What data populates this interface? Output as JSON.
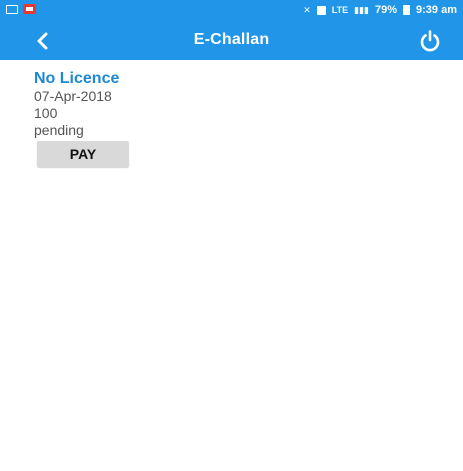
{
  "status_bar": {
    "network_text": "LTE",
    "battery_percent": "79%",
    "time": "9:39 am"
  },
  "app_bar": {
    "back_glyph": "<",
    "title": "E-Challan",
    "power_icon": "power-icon"
  },
  "challan": {
    "offence": "No Licence",
    "date": "07-Apr-2018",
    "amount": "100",
    "status": "pending",
    "pay_label": "PAY"
  },
  "colors": {
    "primary": "#2196e8",
    "title_blue": "#1e88d3",
    "button_bg": "#d9d9d9"
  }
}
